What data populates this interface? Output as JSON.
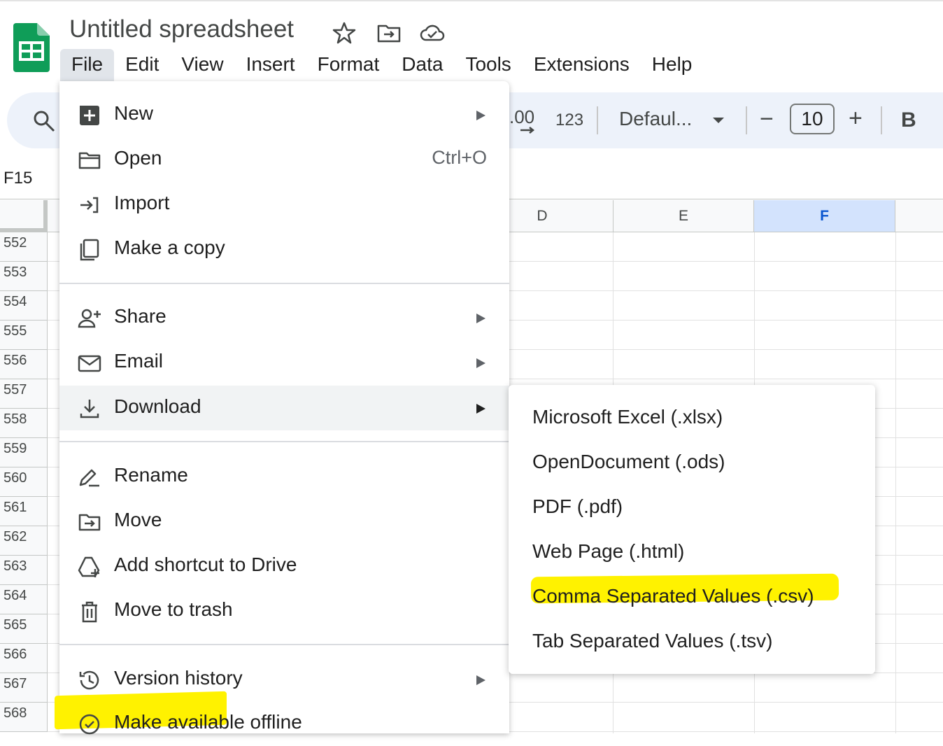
{
  "app": {
    "title": "Untitled spreadsheet",
    "accent_color": "#0f9d58"
  },
  "menubar": {
    "items": [
      {
        "label": "File",
        "active": true
      },
      {
        "label": "Edit"
      },
      {
        "label": "View"
      },
      {
        "label": "Insert"
      },
      {
        "label": "Format"
      },
      {
        "label": "Data"
      },
      {
        "label": "Tools"
      },
      {
        "label": "Extensions"
      },
      {
        "label": "Help"
      }
    ]
  },
  "toolbar": {
    "decimal_label": ".00",
    "number_format_label": "123",
    "font_name": "Defaul...",
    "font_size": "10",
    "minus_label": "−",
    "plus_label": "+",
    "bold_label": "B"
  },
  "name_box": {
    "value": "F15"
  },
  "grid": {
    "columns": [
      "D",
      "E",
      "F"
    ],
    "selected_column": "F",
    "rows": [
      "552",
      "553",
      "554",
      "555",
      "556",
      "557",
      "558",
      "559",
      "560",
      "561",
      "562",
      "563",
      "564",
      "565",
      "566",
      "567",
      "568"
    ]
  },
  "file_menu": {
    "items": [
      {
        "label": "New",
        "icon": "new-sheet-icon",
        "submenu": true
      },
      {
        "label": "Open",
        "icon": "folder-icon",
        "shortcut": "Ctrl+O"
      },
      {
        "label": "Import",
        "icon": "import-icon"
      },
      {
        "label": "Make a copy",
        "icon": "copy-icon"
      },
      {
        "label": "Share",
        "icon": "share-person-icon",
        "submenu": true
      },
      {
        "label": "Email",
        "icon": "email-icon",
        "submenu": true
      },
      {
        "label": "Download",
        "icon": "download-icon",
        "submenu": true,
        "highlighted": true
      },
      {
        "label": "Rename",
        "icon": "rename-icon"
      },
      {
        "label": "Move",
        "icon": "move-folder-icon"
      },
      {
        "label": "Add shortcut to Drive",
        "icon": "drive-shortcut-icon"
      },
      {
        "label": "Move to trash",
        "icon": "trash-icon"
      },
      {
        "label": "Version history",
        "icon": "history-icon",
        "submenu": true
      },
      {
        "label": "Make available offline",
        "icon": "offline-icon"
      }
    ]
  },
  "download_submenu": {
    "items": [
      {
        "label": "Microsoft Excel (.xlsx)"
      },
      {
        "label": "OpenDocument (.ods)"
      },
      {
        "label": "PDF (.pdf)"
      },
      {
        "label": "Web Page (.html)"
      },
      {
        "label": "Comma Separated Values (.csv)",
        "highlighted": true
      },
      {
        "label": "Tab Separated Values (.tsv)"
      }
    ]
  },
  "highlight_color": "#fff200"
}
